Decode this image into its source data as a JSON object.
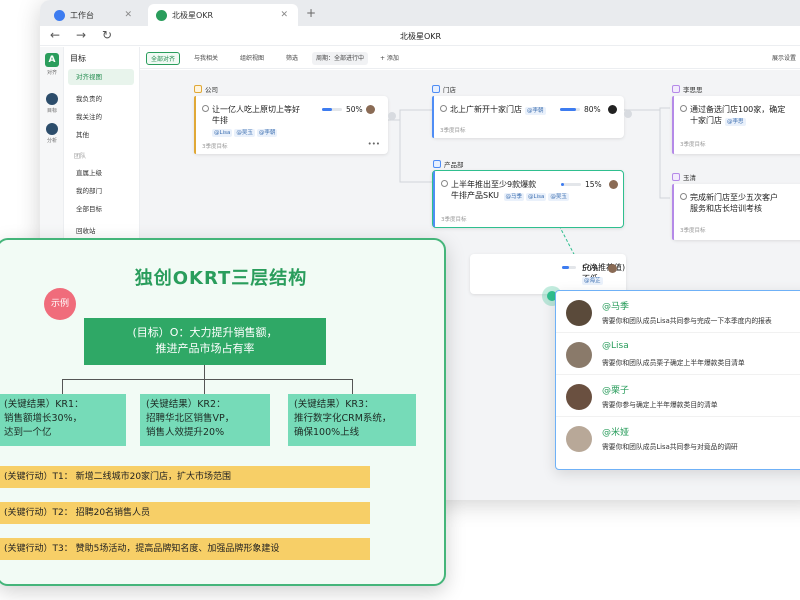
{
  "window": {
    "tabs": [
      {
        "label": "工作台"
      },
      {
        "label": "北极星OKR"
      }
    ],
    "nav_title": "北极星OKR"
  },
  "rail": {
    "items": [
      {
        "label": "对齐"
      },
      {
        "label": "目标"
      },
      {
        "label": "分析"
      }
    ]
  },
  "sidebar": {
    "heading": "目标",
    "items": [
      {
        "label": "对齐视图"
      },
      {
        "label": "我负责的"
      },
      {
        "label": "我关注的"
      },
      {
        "label": "其他"
      }
    ],
    "team_section": "团队",
    "team_items": [
      {
        "label": "直属上级"
      },
      {
        "label": "我的部门"
      },
      {
        "label": "全部目标"
      }
    ],
    "trash": "回收站"
  },
  "toolbar": {
    "buttons": [
      {
        "label": "全部对齐"
      },
      {
        "label": "与我相关"
      },
      {
        "label": "组织视图"
      },
      {
        "label": "筛选"
      }
    ],
    "period": "周期：全部进行中",
    "add": "+ 添加",
    "right": "展示设置"
  },
  "okrs": [
    {
      "header": "公司",
      "title_lines": [
        "让一亿人吃上原切上等好",
        "牛排"
      ],
      "pct": "50%",
      "tags": [
        "@Lisa",
        "@吴玉",
        "@李朝"
      ],
      "foot": "3季度目标",
      "progress": 0.5
    },
    {
      "header": "门店",
      "title_lines": [
        "北上广新开十家门店"
      ],
      "pct": "80%",
      "tags": [
        "@李朝"
      ],
      "foot": "3季度目标",
      "progress": 0.8
    },
    {
      "header": "产品部",
      "title_lines": [
        "上半年推出至少9款爆款",
        "牛排产品SKU"
      ],
      "pct": "15%",
      "tags": [
        "@马季",
        "@Lisa",
        "@吴玉"
      ],
      "foot": "3季度目标",
      "progress": 0.15
    },
    {
      "header": "",
      "title_lines": [
        "户净推荐值)不低"
      ],
      "pct": "50%",
      "tags": [
        "@海芷"
      ],
      "foot": "",
      "progress": 0.5
    },
    {
      "header": "李思思",
      "title_lines": [
        "通过备选门店100家，确定",
        "十家门店"
      ],
      "pct": "",
      "tags": [
        "@李思"
      ],
      "foot": "3季度目标",
      "progress": 0
    },
    {
      "header": "玉清",
      "title_lines": [
        "完成新门店至少五次客户",
        "服务和店长培训考核"
      ],
      "pct": "",
      "tags": [],
      "foot": "3季度目标",
      "progress": 0
    }
  ],
  "mentions": [
    {
      "name": "@马季",
      "text": "需要你和团队成员Lisa共同参与完成一下本季度内的报表",
      "color": "#5a4a3a"
    },
    {
      "name": "@Lisa",
      "text": "需要你和团队成员栗子确定上半年爆款类目清单",
      "color": "#8a7a6a"
    },
    {
      "name": "@栗子",
      "text": "需要你参与确定上半年爆款类目的清单",
      "color": "#6a5040"
    },
    {
      "name": "@米娅",
      "text": "需要你和团队成员Lisa共同参与对竟品的调研",
      "color": "#b8a898"
    }
  ],
  "infocard": {
    "title": "独创OKRT三层结构",
    "badge": "示例",
    "objective_lines": [
      "(目标）O：大力提升销售额，",
      "推进产品市场占有率"
    ],
    "krs": [
      {
        "lines": [
          "(关键结果）KR1：",
          "销售额增长30%，",
          "达到一个亿"
        ]
      },
      {
        "lines": [
          "(关键结果）KR2：",
          "招聘华北区销售VP，",
          "销售人效提升20%"
        ]
      },
      {
        "lines": [
          "(关键结果）KR3：",
          "推行数字化CRM系统，",
          "确保100%上线"
        ]
      }
    ],
    "actions": [
      {
        "label": "(关键行动）T1：   新增二线城市20家门店，扩大市场范围"
      },
      {
        "label": "(关键行动）T2：   招聘20名销售人员"
      },
      {
        "label": "(关键行动）T3：   赞助5场活动，提高品牌知名度、加强品牌形象建设"
      }
    ]
  },
  "colors": {
    "brand_green": "#2a9d5c",
    "kr_green": "#76dbb8",
    "action_yellow": "#f7cf67",
    "badge_pink": "#f06c7b",
    "progress_blue": "#3d7cf0"
  }
}
